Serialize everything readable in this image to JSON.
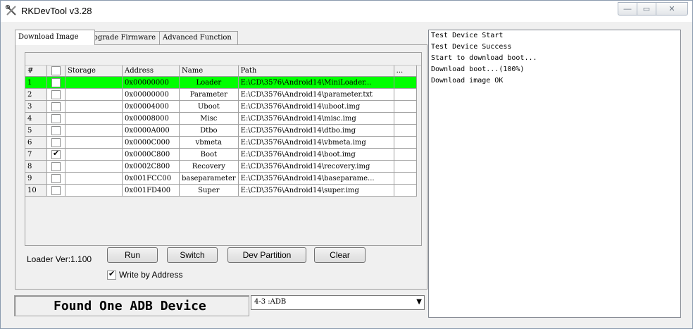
{
  "window": {
    "title": "RKDevTool v3.28"
  },
  "tabs": [
    "Download Image",
    "Upgrade Firmware",
    "Advanced Function"
  ],
  "table": {
    "headers": [
      "#",
      "",
      "Storage",
      "Address",
      "Name",
      "Path",
      "..."
    ],
    "rows": [
      {
        "num": "1",
        "checked": false,
        "storage": "",
        "address": "0x00000000",
        "name": "Loader",
        "path": "E:\\CD\\3576\\Android14\\MiniLoader...",
        "highlight": true
      },
      {
        "num": "2",
        "checked": false,
        "storage": "",
        "address": "0x00000000",
        "name": "Parameter",
        "path": "E:\\CD\\3576\\Android14\\parameter.txt"
      },
      {
        "num": "3",
        "checked": false,
        "storage": "",
        "address": "0x00004000",
        "name": "Uboot",
        "path": "E:\\CD\\3576\\Android14\\uboot.img"
      },
      {
        "num": "4",
        "checked": false,
        "storage": "",
        "address": "0x00008000",
        "name": "Misc",
        "path": "E:\\CD\\3576\\Android14\\misc.img"
      },
      {
        "num": "5",
        "checked": false,
        "storage": "",
        "address": "0x0000A000",
        "name": "Dtbo",
        "path": "E:\\CD\\3576\\Android14\\dtbo.img"
      },
      {
        "num": "6",
        "checked": false,
        "storage": "",
        "address": "0x0000C000",
        "name": "vbmeta",
        "path": "E:\\CD\\3576\\Android14\\vbmeta.img"
      },
      {
        "num": "7",
        "checked": true,
        "storage": "",
        "address": "0x0000C800",
        "name": "Boot",
        "path": "E:\\CD\\3576\\Android14\\boot.img"
      },
      {
        "num": "8",
        "checked": false,
        "storage": "",
        "address": "0x0002C800",
        "name": "Recovery",
        "path": "E:\\CD\\3576\\Android14\\recovery.img"
      },
      {
        "num": "9",
        "checked": false,
        "storage": "",
        "address": "0x001FCC00",
        "name": "baseparameter",
        "path": "E:\\CD\\3576\\Android14\\baseparame..."
      },
      {
        "num": "10",
        "checked": false,
        "storage": "",
        "address": "0x001FD400",
        "name": "Super",
        "path": "E:\\CD\\3576\\Android14\\super.img"
      }
    ]
  },
  "loader_ver": "Loader Ver:1.100",
  "buttons": {
    "run": "Run",
    "switch": "Switch",
    "dev_partition": "Dev Partition",
    "clear": "Clear"
  },
  "write_by_address": {
    "label": "Write by Address",
    "checked": true
  },
  "status_text": "Found One ADB Device",
  "device_select": {
    "value": "4-3 :ADB"
  },
  "log": [
    "Test Device Start",
    "Test Device Success",
    "Start to download boot...",
    "Download boot...(100%)",
    "Download image OK"
  ],
  "colors": {
    "highlight_row": "#00ff00"
  }
}
